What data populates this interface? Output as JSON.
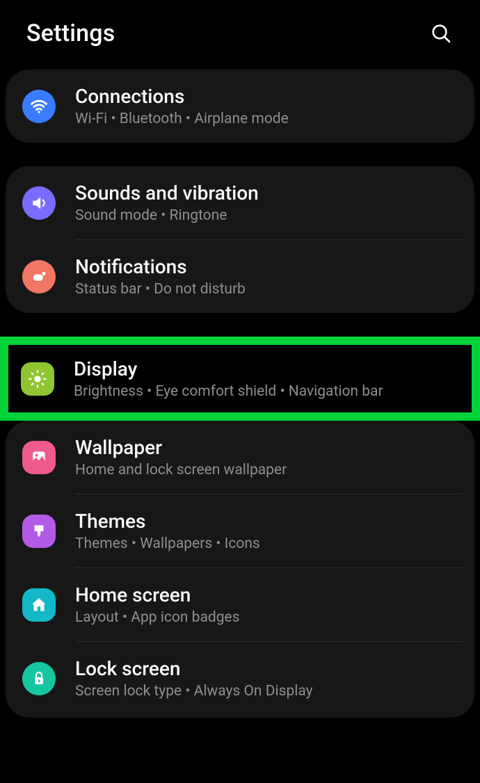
{
  "header": {
    "title": "Settings"
  },
  "groups": [
    {
      "items": [
        {
          "key": "connections",
          "title": "Connections",
          "subtitle": "Wi-Fi  •  Bluetooth  •  Airplane mode",
          "icon": "wifi-icon",
          "iconClass": "icon-wifi"
        }
      ]
    },
    {
      "items": [
        {
          "key": "sounds",
          "title": "Sounds and vibration",
          "subtitle": "Sound mode  •  Ringtone",
          "icon": "sound-icon",
          "iconClass": "icon-sound"
        },
        {
          "key": "notifications",
          "title": "Notifications",
          "subtitle": "Status bar  •  Do not disturb",
          "icon": "bell-icon",
          "iconClass": "icon-notif"
        }
      ]
    }
  ],
  "display_row": {
    "key": "display",
    "title": "Display",
    "subtitle": "Brightness  •  Eye comfort shield  •  Navigation bar",
    "icon": "brightness-icon",
    "iconClass": "icon-display",
    "highlighted": true
  },
  "display_group_rest": [
    {
      "key": "wallpaper",
      "title": "Wallpaper",
      "subtitle": "Home and lock screen wallpaper",
      "icon": "image-icon",
      "iconClass": "icon-wall"
    },
    {
      "key": "themes",
      "title": "Themes",
      "subtitle": "Themes  •  Wallpapers  •  Icons",
      "icon": "brush-icon",
      "iconClass": "icon-themes"
    },
    {
      "key": "homescreen",
      "title": "Home screen",
      "subtitle": "Layout  •  App icon badges",
      "icon": "home-icon",
      "iconClass": "icon-home"
    },
    {
      "key": "lockscreen",
      "title": "Lock screen",
      "subtitle": "Screen lock type  •  Always On Display",
      "icon": "lock-icon",
      "iconClass": "icon-lock"
    }
  ]
}
